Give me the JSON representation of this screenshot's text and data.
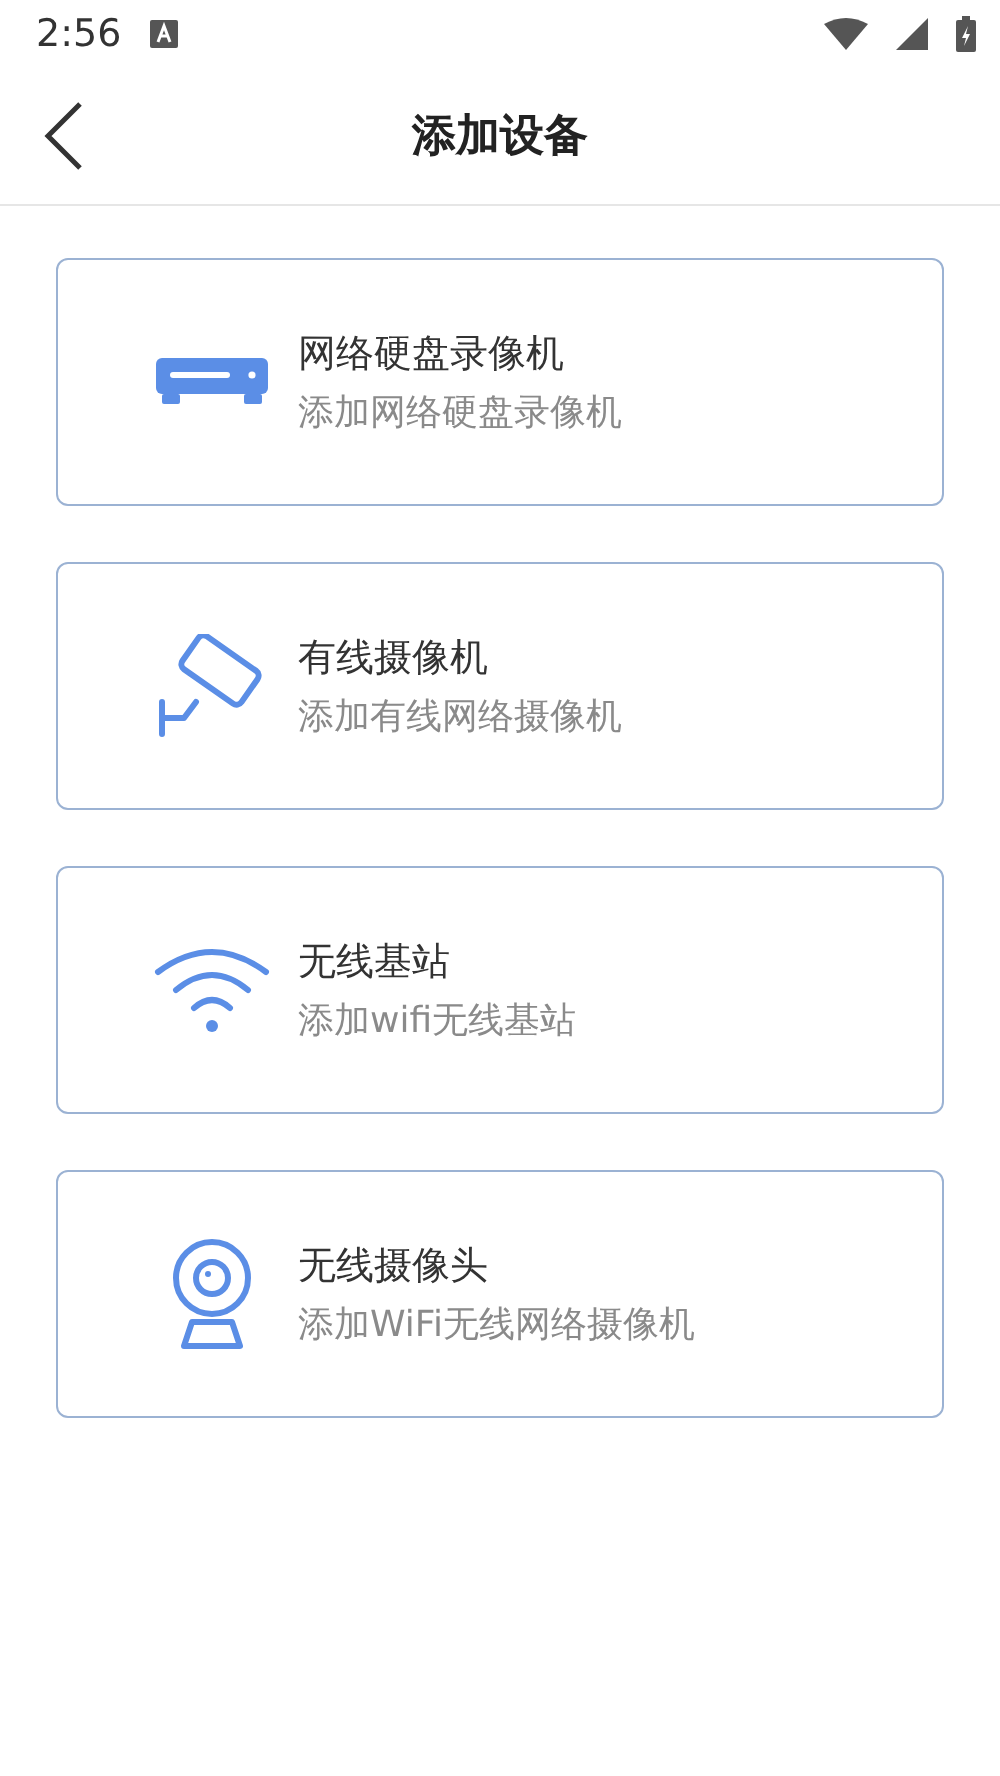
{
  "status_bar": {
    "time": "2:56"
  },
  "header": {
    "title": "添加设备"
  },
  "devices": [
    {
      "kind": "nvr",
      "title": "网络硬盘录像机",
      "subtitle": "添加网络硬盘录像机"
    },
    {
      "kind": "camera",
      "title": "有线摄像机",
      "subtitle": "添加有线网络摄像机"
    },
    {
      "kind": "wifi",
      "title": "无线基站",
      "subtitle": "添加wifi无线基站"
    },
    {
      "kind": "webcam",
      "title": "无线摄像头",
      "subtitle": "添加WiFi无线网络摄像机"
    }
  ]
}
